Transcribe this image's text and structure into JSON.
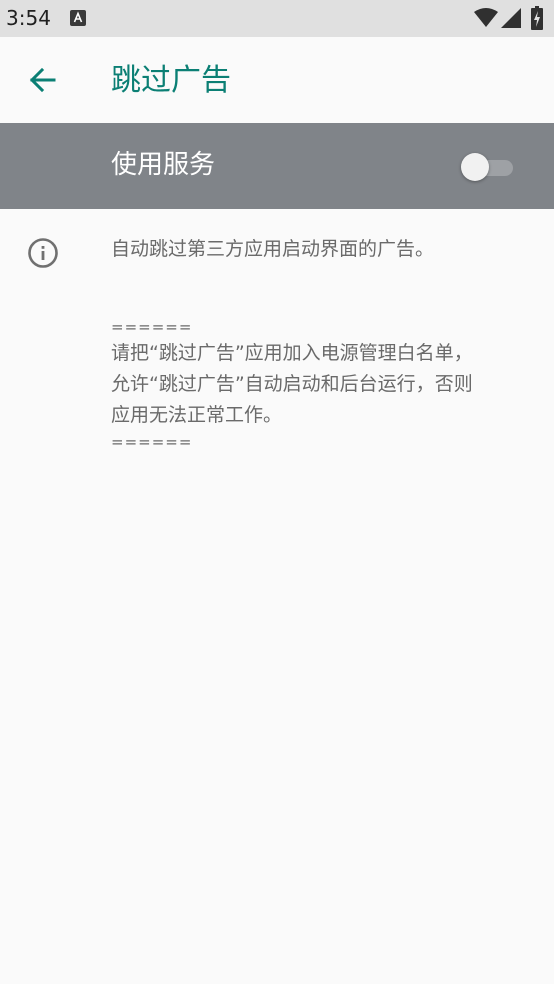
{
  "status_bar": {
    "time": "3:54",
    "notification_icon": "a-icon",
    "wifi_icon": "wifi-icon",
    "signal_icon": "signal-icon",
    "battery_icon": "battery-charging-icon"
  },
  "app_bar": {
    "back_icon": "arrow-back-icon",
    "title": "跳过广告",
    "accent_color": "#0b7f74"
  },
  "service": {
    "label": "使用服务",
    "enabled": false,
    "bar_color": "#808489"
  },
  "info": {
    "icon": "info-icon",
    "summary": "自动跳过第三方应用启动界面的广告。",
    "separator_top": "======",
    "notice_lines": [
      "请把“跳过广告”应用加入电源管理白名单，",
      "允许“跳过广告”自动启动和后台运行，否则",
      "应用无法正常工作。"
    ],
    "separator_bottom": "======"
  }
}
